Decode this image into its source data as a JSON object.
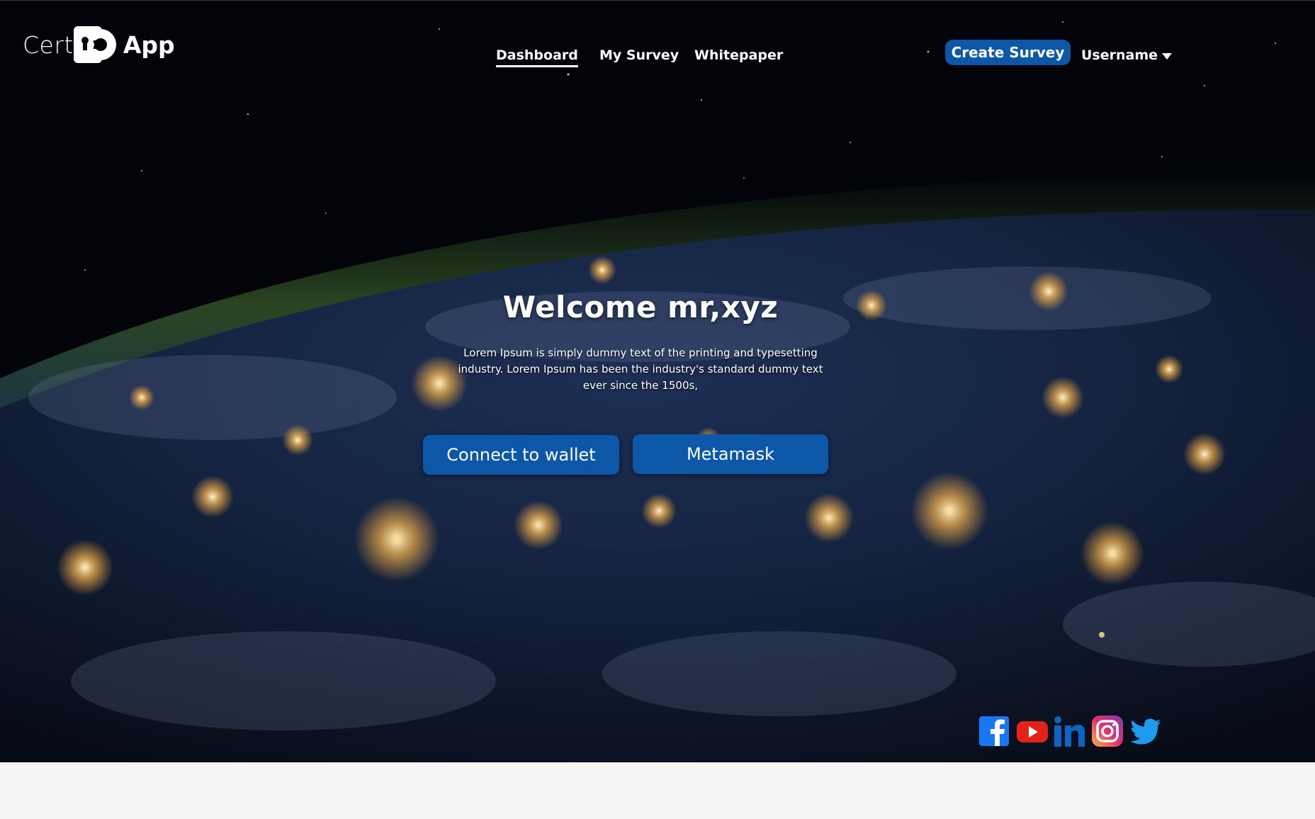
{
  "brand": {
    "prefix": "Cert",
    "suffix": "App"
  },
  "nav": {
    "items": [
      {
        "label": "Dashboard",
        "active": true
      },
      {
        "label": "My Survey",
        "active": false
      },
      {
        "label": "Whitepaper",
        "active": false
      }
    ]
  },
  "header": {
    "create_label": "Create Survey",
    "username": "Username"
  },
  "hero": {
    "title": "Welcome mr,xyz",
    "description": "Lorem Ipsum is simply dummy text of the printing and typesetting industry. Lorem Ipsum has been the industry's standard dummy text ever since the 1500s,",
    "connect_label": "Connect to wallet",
    "metamask_label": "Metamask"
  },
  "social": [
    "facebook-icon",
    "youtube-icon",
    "linkedin-icon",
    "instagram-icon",
    "twitter-icon"
  ],
  "colors": {
    "accent": "#0d57a8",
    "background_dark": "#02040a",
    "footer": "#f5f5f5"
  }
}
